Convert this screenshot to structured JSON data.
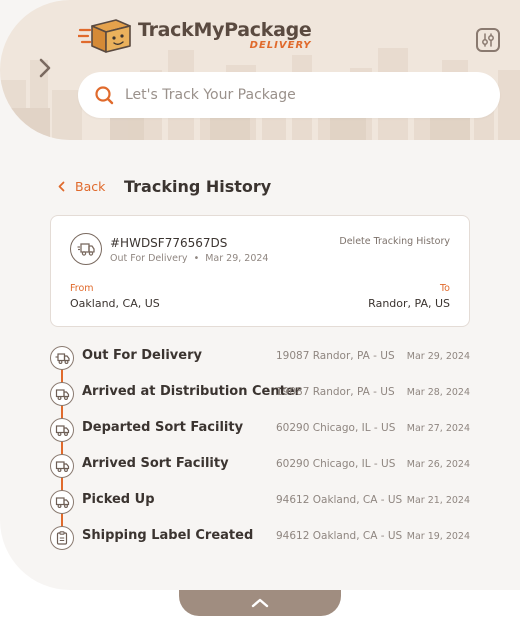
{
  "header": {
    "brand_title": "TrackMyPackage",
    "brand_subtitle": "DELIVERY",
    "search_placeholder": "Let's Track Your Package",
    "icons": {
      "side": "chevron-right-icon",
      "settings": "sliders-icon",
      "search": "search-icon"
    }
  },
  "nav": {
    "back_label": "Back",
    "page_title": "Tracking History"
  },
  "summary": {
    "tracking_number": "#HWDSF776567DS",
    "status": "Out For Delivery",
    "separator": "•",
    "date": "Mar 29, 2024",
    "delete_label": "Delete Tracking History",
    "from_label": "From",
    "from_value": "Oakland, CA, US",
    "to_label": "To",
    "to_value": "Randor, PA, US"
  },
  "events": [
    {
      "title": "Out For Delivery",
      "location": "19087 Randor, PA - US",
      "date": "Mar 29, 2024",
      "icon": "delivery-truck-icon"
    },
    {
      "title": "Arrived at Distribution Center",
      "location": "19087 Randor, PA - US",
      "date": "Mar 28, 2024",
      "icon": "truck-icon"
    },
    {
      "title": "Departed Sort Facility",
      "location": "60290 Chicago, IL - US",
      "date": "Mar 27, 2024",
      "icon": "truck-icon"
    },
    {
      "title": "Arrived Sort Facility",
      "location": "60290 Chicago, IL - US",
      "date": "Mar 26, 2024",
      "icon": "truck-icon"
    },
    {
      "title": "Picked Up",
      "location": "94612 Oakland, CA - US",
      "date": "Mar 21, 2024",
      "icon": "truck-icon"
    },
    {
      "title": "Shipping Label Created",
      "location": "94612 Oakland, CA - US",
      "date": "Mar 19, 2024",
      "icon": "clipboard-icon"
    }
  ],
  "colors": {
    "accent": "#e06a2c",
    "header_bg": "#f0e6dc",
    "page_bg": "#f7f5f3",
    "text_dark": "#3b3430",
    "text_muted": "#8f8680",
    "bottom_tab": "#a08d80"
  }
}
